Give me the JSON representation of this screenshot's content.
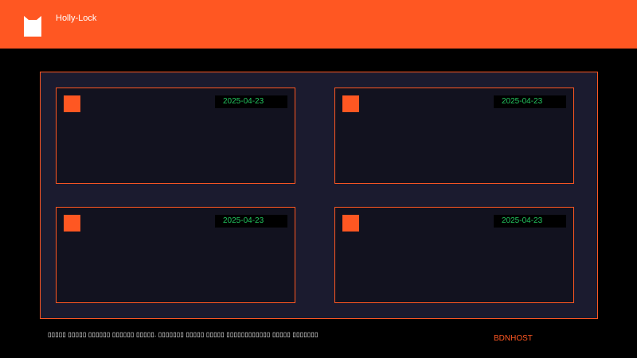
{
  "header": {
    "title": "Holly-Lock",
    "logo_icon": "cat-logo-icon"
  },
  "cards": [
    {
      "date": "2025-04-23",
      "icon": "orange-square-icon"
    },
    {
      "date": "2025-04-23",
      "icon": "orange-square-icon"
    },
    {
      "date": "2025-04-23",
      "icon": "orange-square-icon"
    },
    {
      "date": "2025-04-23",
      "icon": "orange-square-icon"
    }
  ],
  "footer": {
    "text": "▯▯▯▯▯ ▯▯▯▯▯ ▯▯▯▯▯▯ ▯▯▯▯▯▯ ▯▯▯▯▯. ▯▯▯▯▯▯▯ ▯▯▯▯▯ ▯▯▯▯▯ ▯▯▯▯▯▯▯▯▯▯▯▯ ▯▯▯▯▯ ▯▯▯▯▯▯▯",
    "brand": "BDNHOST"
  },
  "colors": {
    "accent": "#ff5722",
    "date_text": "#22c55e",
    "panel_bg": "#1b1b2f",
    "card_bg": "#12121f"
  }
}
